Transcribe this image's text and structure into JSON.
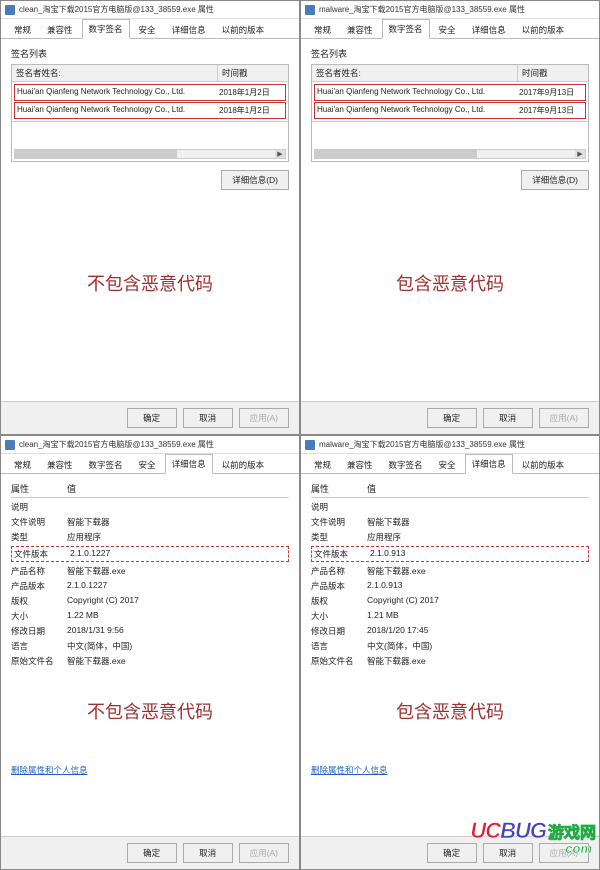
{
  "windows": {
    "tl": {
      "title": "clean_淘宝下载2015官方电脑版@133_38559.exe 属性"
    },
    "tr": {
      "title": "malware_淘宝下载2015官方电脑版@133_38559.exe 属性"
    },
    "bl": {
      "title": "clean_淘宝下载2015官方电脑版@133_38559.exe 属性"
    },
    "br": {
      "title": "malware_淘宝下载2015官方电脑版@133_38559.exe 属性"
    }
  },
  "tabs": {
    "general": "常规",
    "compat": "兼容性",
    "digsig": "数字签名",
    "security": "安全",
    "details": "详细信息",
    "prev": "以前的版本"
  },
  "sig": {
    "group_label": "签名列表",
    "col_name": "签名者姓名:",
    "col_time": "时间戳",
    "detail_btn": "详细信息(D)",
    "signer": "Huai'an Qianfeng Network Technology Co., Ltd.",
    "clean_date": "2018年1月2日",
    "malware_date": "2017年9月13日"
  },
  "verdict": {
    "clean": "不包含恶意代码",
    "malware": "包含恶意代码"
  },
  "bottom": {
    "ok": "确定",
    "cancel": "取消",
    "apply": "应用(A)"
  },
  "details": {
    "prop_head": "属性",
    "val_head": "值",
    "desc_label": "说明",
    "rows": {
      "file_desc_k": "文件说明",
      "file_desc_v": "智能下载器",
      "type_k": "类型",
      "type_v": "应用程序",
      "file_ver_k": "文件版本",
      "file_ver_clean": "2.1.0.1227",
      "file_ver_malware": "2.1.0.913",
      "prod_name_k": "产品名称",
      "prod_name_v": "智能下载器.exe",
      "prod_ver_k": "产品版本",
      "prod_ver_clean": "2.1.0.1227",
      "prod_ver_malware": "2.1.0.913",
      "copyright_k": "版权",
      "copyright_v": "Copyright (C) 2017",
      "size_k": "大小",
      "size_clean": "1.22 MB",
      "size_malware": "1.21 MB",
      "modified_k": "修改日期",
      "modified_clean": "2018/1/31 9:56",
      "modified_malware": "2018/1/20 17:45",
      "lang_k": "语言",
      "lang_v": "中文(简体，中国)",
      "orig_name_k": "原始文件名",
      "orig_name_v": "智能下载器.exe"
    },
    "remove_link": "删除属性和个人信息"
  },
  "watermark": {
    "uc": "UC",
    "bug": "BUG",
    "han": "游戏网",
    "sub": ".com"
  }
}
